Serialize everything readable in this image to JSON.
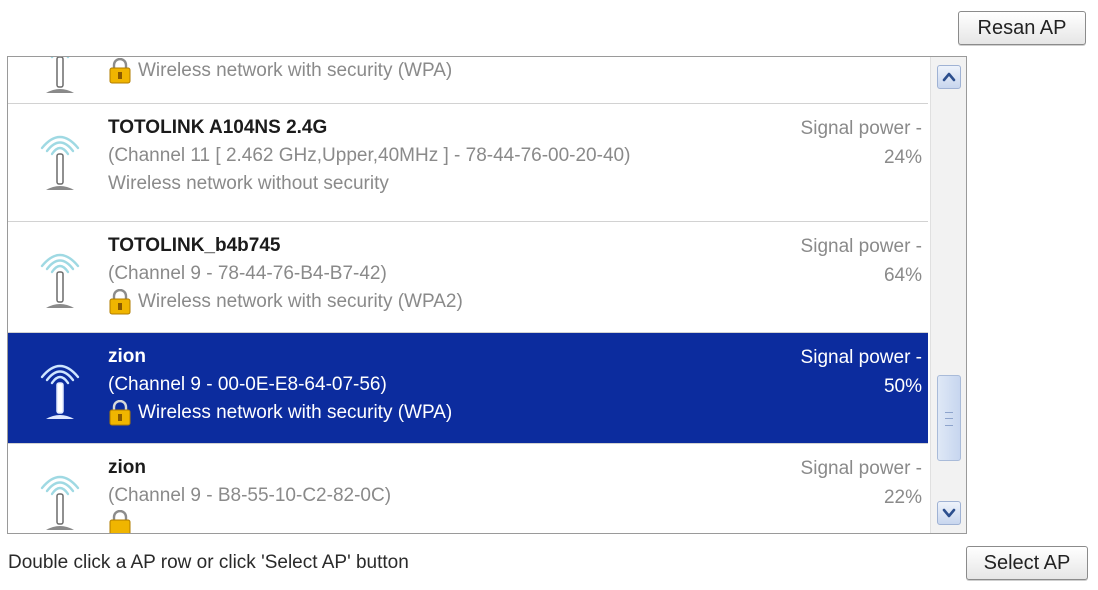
{
  "buttons": {
    "rescan": "Resan AP",
    "select": "Select AP"
  },
  "hint": "Double click a AP row or click 'Select AP' button",
  "colors": {
    "selected_row": "#0c2c9e",
    "muted_text": "#8a8a8a"
  },
  "ap_list": [
    {
      "name": "",
      "detail": "",
      "security": "Wireless network with security (WPA)",
      "has_lock": true,
      "signal_label": "",
      "signal_value": "",
      "icon": "wifi-antenna-icon",
      "selected": false
    },
    {
      "name": "TOTOLINK A104NS 2.4G",
      "detail": "(Channel 11 [ 2.462 GHz,Upper,40MHz ] - 78-44-76-00-20-40)",
      "security": "Wireless network without security",
      "has_lock": false,
      "signal_label": "Signal power -",
      "signal_value": "24%",
      "icon": "wifi-antenna-icon",
      "selected": false
    },
    {
      "name": "TOTOLINK_b4b745",
      "detail": "(Channel 9 - 78-44-76-B4-B7-42)",
      "security": "Wireless network with security (WPA2)",
      "has_lock": true,
      "signal_label": "Signal power -",
      "signal_value": "64%",
      "icon": "wifi-antenna-icon",
      "selected": false
    },
    {
      "name": "zion",
      "detail": "(Channel 9 - 00-0E-E8-64-07-56)",
      "security": "Wireless network with security (WPA)",
      "has_lock": true,
      "signal_label": "Signal power -",
      "signal_value": "50%",
      "icon": "wifi-antenna-icon",
      "selected": true
    },
    {
      "name": "zion",
      "detail": "(Channel 9 - B8-55-10-C2-82-0C)",
      "security": "",
      "has_lock": true,
      "signal_label": "Signal power -",
      "signal_value": "22%",
      "icon": "wifi-antenna-icon",
      "selected": false
    }
  ]
}
